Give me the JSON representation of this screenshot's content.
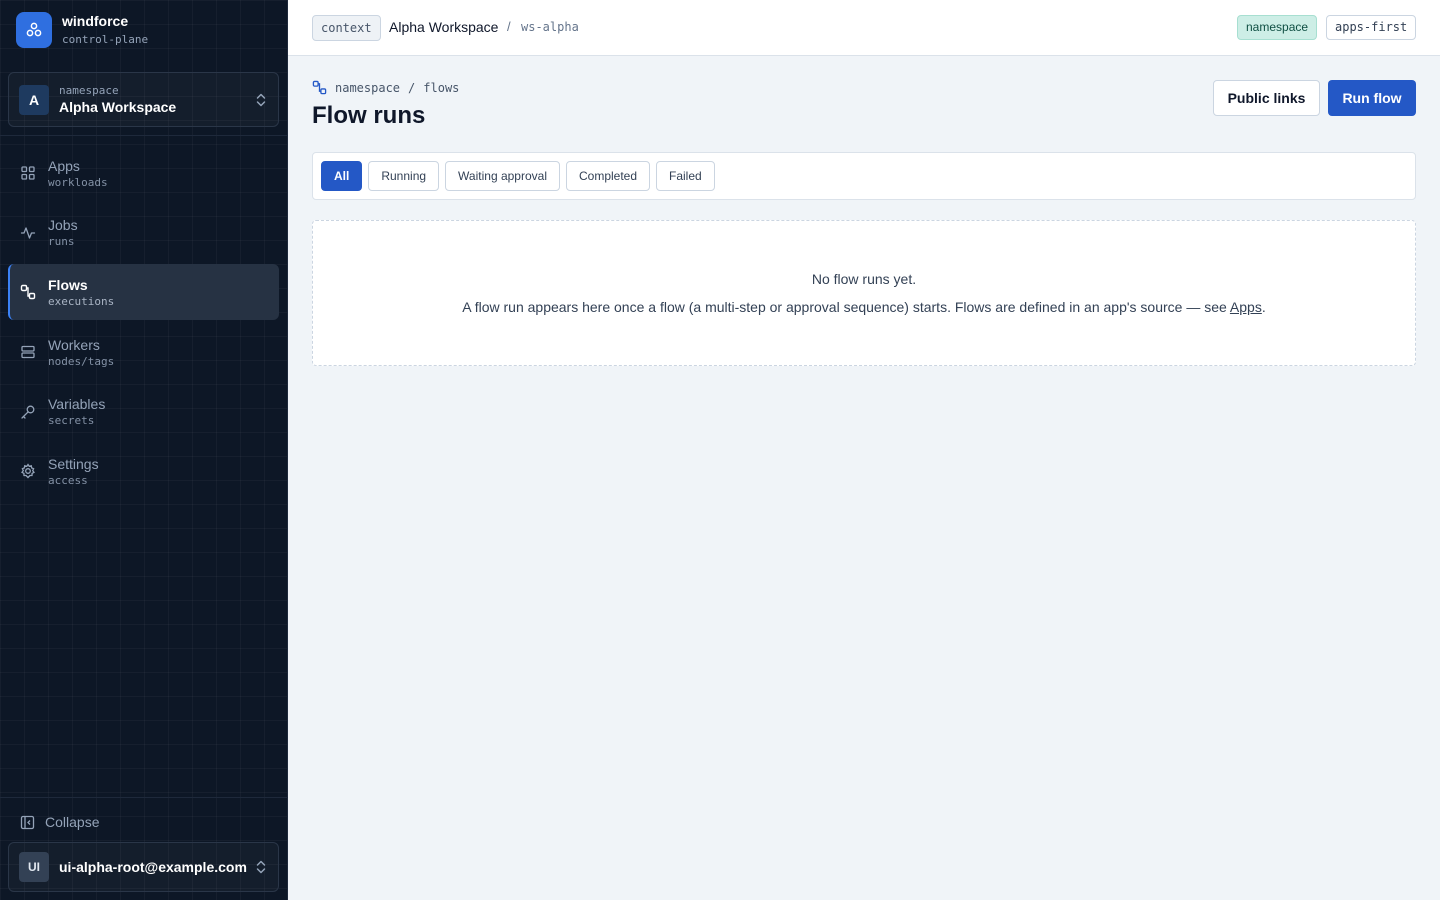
{
  "brand": {
    "name": "windforce",
    "subtitle": "control-plane"
  },
  "namespace_switcher": {
    "avatar": "A",
    "label": "namespace",
    "name": "Alpha Workspace"
  },
  "nav": [
    {
      "label": "Apps",
      "sub": "workloads",
      "icon": "grid-icon"
    },
    {
      "label": "Jobs",
      "sub": "runs",
      "icon": "activity-icon"
    },
    {
      "label": "Flows",
      "sub": "executions",
      "icon": "flow-icon",
      "active": true
    },
    {
      "label": "Workers",
      "sub": "nodes/tags",
      "icon": "server-icon"
    },
    {
      "label": "Variables",
      "sub": "secrets",
      "icon": "key-icon"
    },
    {
      "label": "Settings",
      "sub": "access",
      "icon": "gear-icon"
    }
  ],
  "collapse": {
    "label": "Collapse"
  },
  "user": {
    "initials": "UI",
    "email": "ui-alpha-root@example.com"
  },
  "topbar": {
    "context_chip": "context",
    "context_name": "Alpha Workspace",
    "separator": "/",
    "context_id": "ws-alpha",
    "tags": [
      "namespace",
      "apps-first"
    ]
  },
  "page": {
    "breadcrumb": [
      "namespace",
      "flows"
    ],
    "breadcrumb_sep": "/",
    "title": "Flow runs",
    "buttons": {
      "public_links": "Public links",
      "run_flow": "Run flow"
    },
    "filters": [
      "All",
      "Running",
      "Waiting approval",
      "Completed",
      "Failed"
    ],
    "active_filter": "All",
    "empty": {
      "title": "No flow runs yet.",
      "desc_before": "A flow run appears here once a flow (a multi-step or approval sequence) starts. Flows are defined in an app's source — see ",
      "link": "Apps",
      "desc_after": "."
    }
  },
  "colors": {
    "accent": "#2458c6",
    "sidebar_bg": "#0d1726",
    "page_bg": "#f0f4f8",
    "ns_tag_bg": "#cdeee6"
  }
}
